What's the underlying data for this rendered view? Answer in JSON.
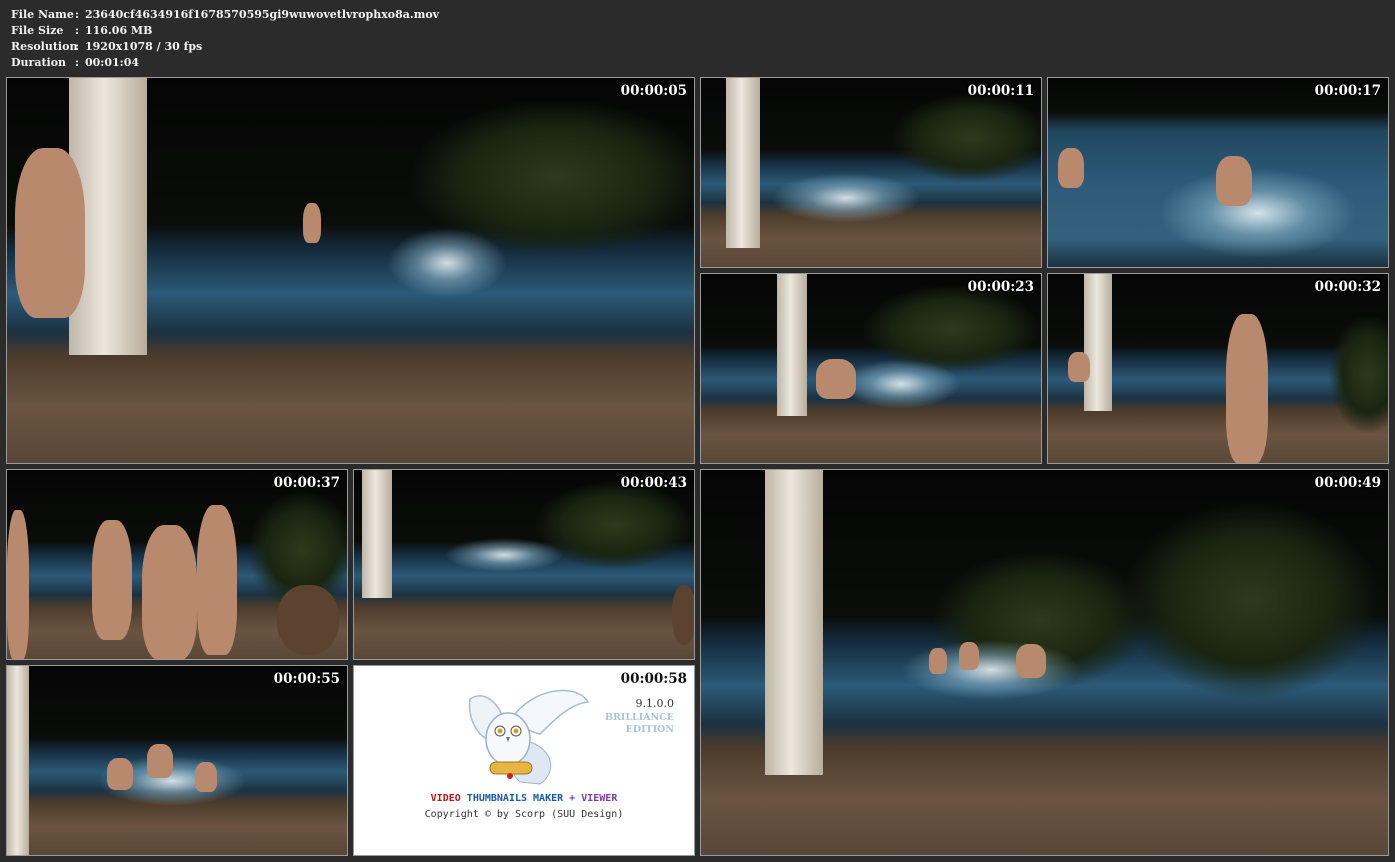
{
  "info": {
    "rows": [
      {
        "label": "File Name",
        "sep": ":",
        "value": "23640cf4634916f1678570595gi9wuwovetlvrophxo8a.mov"
      },
      {
        "label": "File Size",
        "sep": ":",
        "value": "116.06 MB"
      },
      {
        "label": "Resolution",
        "sep": ":",
        "value": "1920x1078 / 30 fps"
      },
      {
        "label": "Duration",
        "sep": ":",
        "value": "00:01:04"
      }
    ]
  },
  "thumbnails": [
    {
      "timestamp": "00:00:05"
    },
    {
      "timestamp": "00:00:11"
    },
    {
      "timestamp": "00:00:17"
    },
    {
      "timestamp": "00:00:23"
    },
    {
      "timestamp": "00:00:32"
    },
    {
      "timestamp": "00:00:37"
    },
    {
      "timestamp": "00:00:43"
    },
    {
      "timestamp": "00:00:49"
    },
    {
      "timestamp": "00:00:55"
    },
    {
      "timestamp": "00:00:58"
    }
  ],
  "logo": {
    "version": "9.1.0.0",
    "edition_line1": "BRILLIANCE",
    "edition_line2": "EDITION",
    "product_part1": "VIDEO",
    "product_part2": "THUMBNAILS MAKER",
    "product_part3": "+",
    "product_part4": "VIEWER",
    "copyright": "Copyright © by Scorp (SUU Design)"
  }
}
